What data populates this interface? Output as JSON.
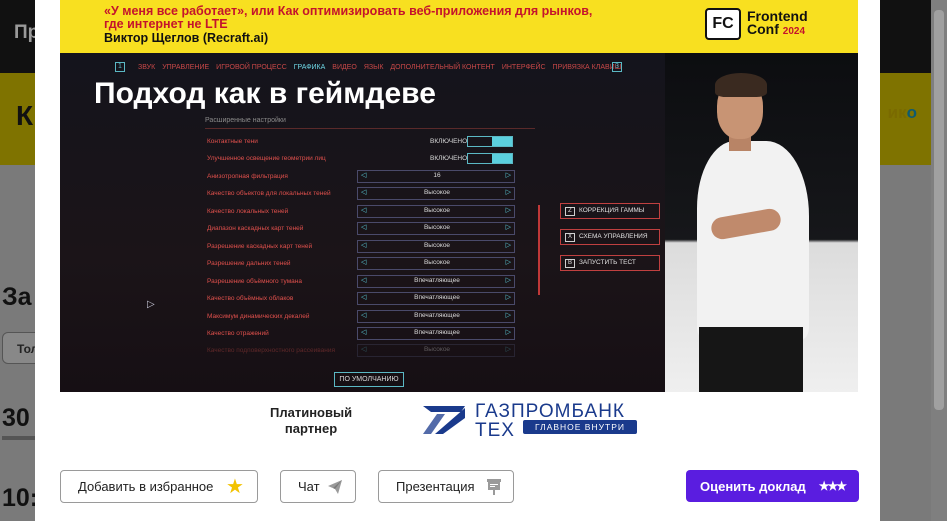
{
  "background": {
    "top_text": "Пр",
    "yellow_text": "К",
    "logo_fragment": {
      "a": "ик",
      "b": "о"
    },
    "heading": "За",
    "button": "Тол",
    "number1": "30",
    "number2": "10:"
  },
  "video": {
    "banner": {
      "line1": "«У меня все работает», или Как оптимизировать веб-приложения для рынков,",
      "line2": "где интернет не LTE",
      "author": "Виктор Щеглов (Recraft.ai)",
      "conf_logo_box": "FC",
      "conf_name_1": "Frontend",
      "conf_name_2": "Conf",
      "conf_year": "2024"
    },
    "slide": {
      "title": "Подход как в геймдеве",
      "tab_num_left": "1",
      "tab_num_right": "3",
      "tabs": [
        "ЗВУК",
        "УПРАВЛЕНИЕ",
        "ИГРОВОЙ ПРОЦЕСС",
        "ГРАФИКА",
        "ВИДЕО",
        "ЯЗЫК",
        "ДОПОЛНИТЕЛЬНЫЙ КОНТЕНТ",
        "ИНТЕРФЕЙС",
        "ПРИВЯЗКА КЛАВИШ"
      ],
      "section": "Расширенные настройки",
      "settings": [
        {
          "label": "Контактные тени",
          "value": "ВКЛЮЧЕНО"
        },
        {
          "label": "Улучшенное освещение геометрии лиц",
          "value": "ВКЛЮЧЕНО"
        },
        {
          "label": "Анизотропная фильтрация",
          "value": "16"
        },
        {
          "label": "Качество объектов для локальных теней",
          "value": "Высокое"
        },
        {
          "label": "Качество локальных теней",
          "value": "Высокое"
        },
        {
          "label": "Диапазон каскадных карт теней",
          "value": "Высокое"
        },
        {
          "label": "Разрешение каскадных карт теней",
          "value": "Высокое"
        },
        {
          "label": "Разрешение дальних теней",
          "value": "Высокое"
        },
        {
          "label": "Разрешение объёмного тумана",
          "value": "Впечатляющее"
        },
        {
          "label": "Качество объёмных облаков",
          "value": "Впечатляющее"
        },
        {
          "label": "Максимум динамических декалей",
          "value": "Впечатляющее"
        },
        {
          "label": "Качество отражений",
          "value": "Впечатляющее"
        },
        {
          "label": "Качество подповерхностного рассеивания",
          "value": "Высокое"
        }
      ],
      "side_buttons": [
        {
          "key": "Z",
          "label": "КОРРЕКЦИЯ ГАММЫ"
        },
        {
          "key": "X",
          "label": "СХЕМА УПРАВЛЕНИЯ"
        },
        {
          "key": "B",
          "label": "ЗАПУСТИТЬ ТЕСТ"
        }
      ],
      "default_button": "ПО УМОЛЧАНИЮ"
    }
  },
  "partner": {
    "label_line1": "Платиновый",
    "label_line2": "партнер",
    "name_line1": "ГАЗПРОМБАНК",
    "name_line2": "ТЕХ",
    "tagline": "ГЛАВНОЕ ВНУТРИ"
  },
  "actions": {
    "favorite": "Добавить в избранное",
    "chat": "Чат",
    "presentation": "Презентация",
    "rate": "Оценить доклад"
  },
  "colors": {
    "accent": "#5a1de0",
    "banner": "#f8e020",
    "partner": "#1a3a8c"
  }
}
